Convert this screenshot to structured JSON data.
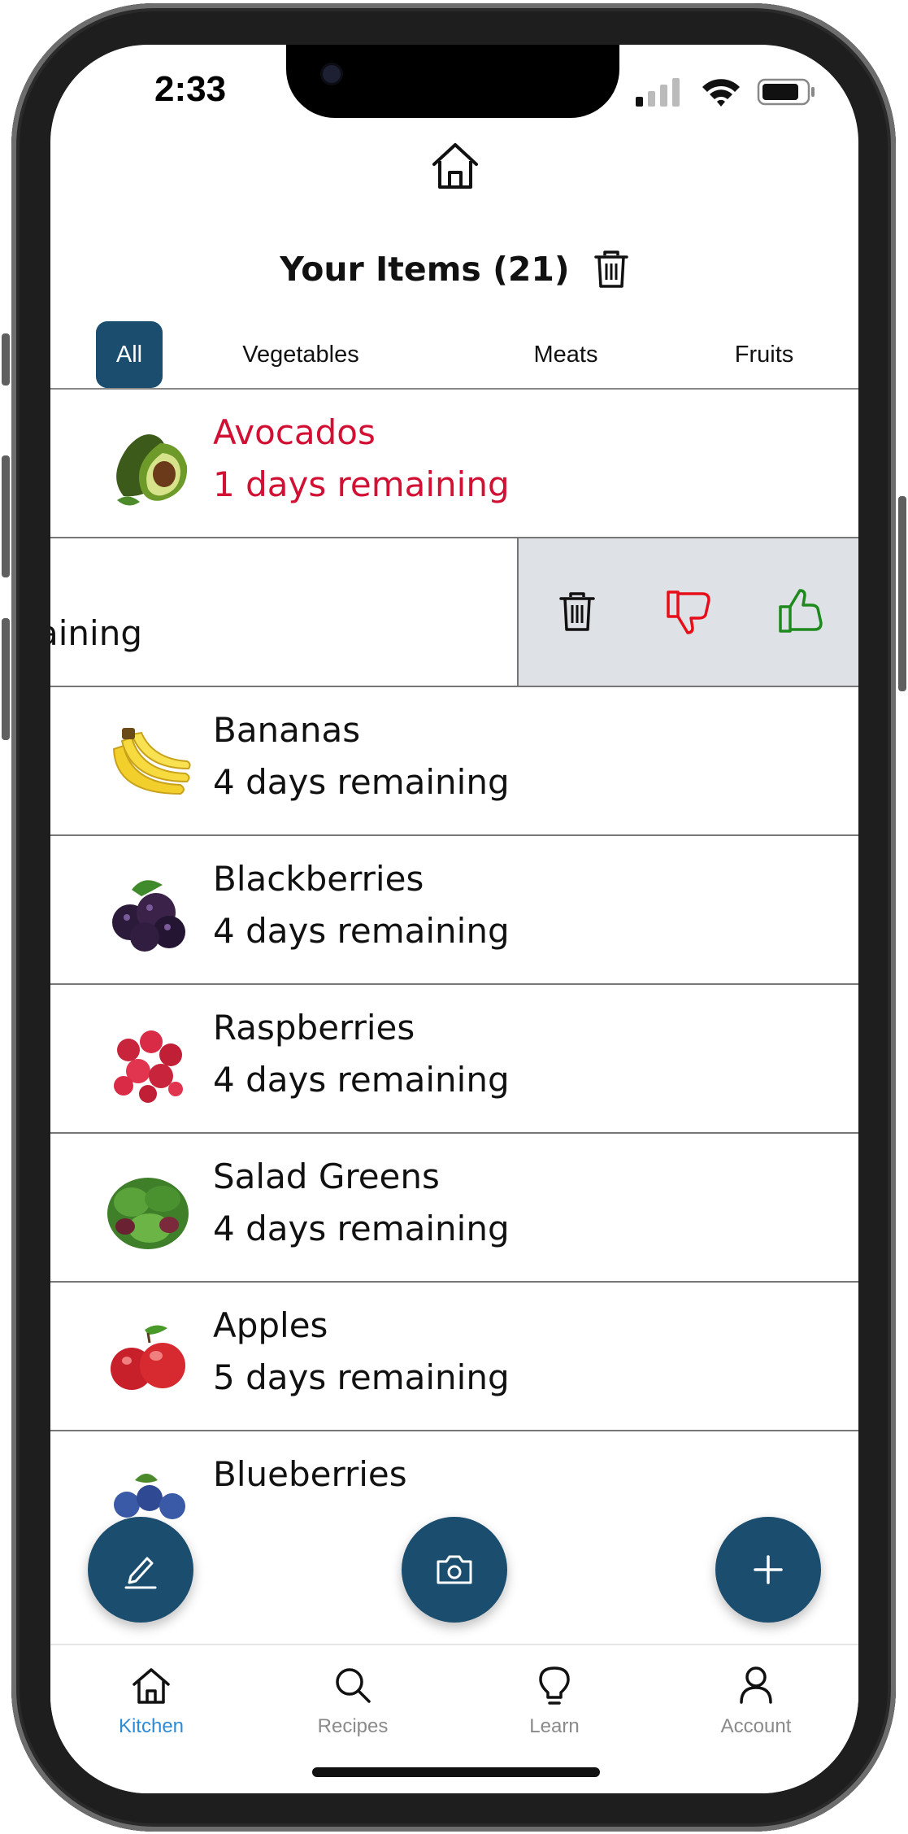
{
  "status_bar": {
    "time": "2:33"
  },
  "header": {
    "title": "Your Items (21)"
  },
  "filters": {
    "tabs": [
      {
        "label": "All",
        "active": true
      },
      {
        "label": "Vegetables",
        "active": false
      },
      {
        "label": "Meats",
        "active": false
      },
      {
        "label": "Fruits",
        "active": false
      }
    ]
  },
  "items": [
    {
      "name": "Avocados",
      "days": "1 days remaining",
      "urgent": true,
      "icon": "avocado-icon"
    },
    {
      "name": "",
      "days": "aining",
      "swiped": true,
      "icon": ""
    },
    {
      "name": "Bananas",
      "days": "4 days remaining",
      "icon": "banana-icon"
    },
    {
      "name": "Blackberries",
      "days": "4 days remaining",
      "icon": "blackberry-icon"
    },
    {
      "name": "Raspberries",
      "days": "4 days remaining",
      "icon": "raspberry-icon"
    },
    {
      "name": "Salad Greens",
      "days": "4 days remaining",
      "icon": "salad-greens-icon"
    },
    {
      "name": "Apples",
      "days": "5 days remaining",
      "icon": "apple-icon"
    },
    {
      "name": "Blueberries",
      "days": "",
      "icon": "blueberry-icon"
    }
  ],
  "swipe_actions": [
    "trash-icon",
    "thumbs-down-icon",
    "thumbs-up-icon"
  ],
  "colors": {
    "accent": "#1b4d6f",
    "urgent": "#d11034",
    "thumbs_down": "#e60f19",
    "thumbs_up": "#1e8a1e",
    "tab_active_label": "#2d8bd6",
    "swipe_bg": "#dee1e5"
  },
  "fabs": [
    "edit-pencil-icon",
    "camera-icon",
    "plus-icon"
  ],
  "tabbar": {
    "items": [
      {
        "label": "Kitchen",
        "active": true,
        "icon": "home-icon"
      },
      {
        "label": "Recipes",
        "active": false,
        "icon": "search-icon"
      },
      {
        "label": "Learn",
        "active": false,
        "icon": "lightbulb-icon"
      },
      {
        "label": "Account",
        "active": false,
        "icon": "person-icon"
      }
    ]
  }
}
